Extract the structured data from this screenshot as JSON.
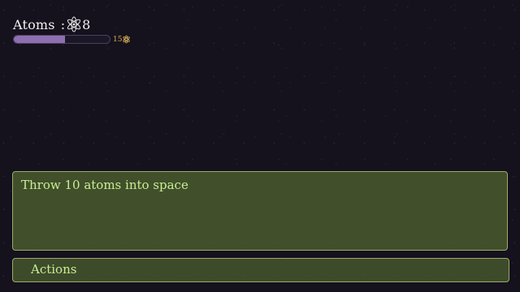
{
  "hud": {
    "atoms_label": "Atoms",
    "separator": ":",
    "atom_icon": "atom-icon",
    "atoms_count": "8",
    "progress_fraction": 0.53,
    "progress_max": "15",
    "progress_cap_icon": "atom-icon"
  },
  "message_box": {
    "text": "Throw 10 atoms into space"
  },
  "actions": {
    "label": "Actions"
  },
  "colors": {
    "background": "#15111d",
    "progress_fill": "#8e6fb2",
    "panel": "#4a5c2e",
    "panel_text": "#c8ee96",
    "cap_text": "#d4b154"
  }
}
